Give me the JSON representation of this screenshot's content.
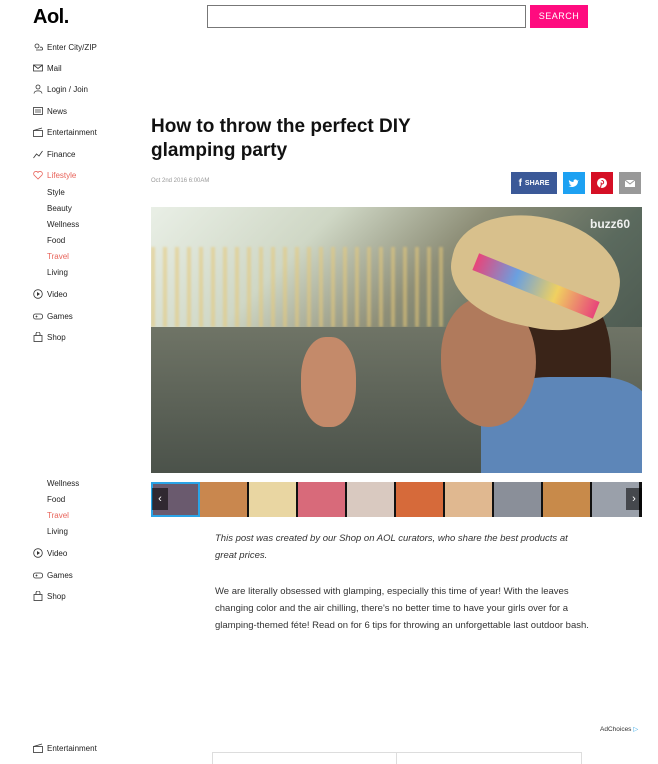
{
  "header": {
    "logo": "Aol.",
    "search_placeholder": "",
    "search_button": "SEARCH"
  },
  "sidebar": {
    "items": [
      {
        "label": "Enter City/ZIP",
        "icon": "weather-icon"
      },
      {
        "label": "Mail",
        "icon": "mail-icon"
      },
      {
        "label": "Login / Join",
        "icon": "user-icon"
      },
      {
        "label": "News",
        "icon": "news-icon"
      },
      {
        "label": "Entertainment",
        "icon": "clapper-icon"
      },
      {
        "label": "Finance",
        "icon": "chart-icon"
      },
      {
        "label": "Lifestyle",
        "icon": "heart-icon",
        "active": true
      }
    ],
    "lifestyle_sub": [
      "Style",
      "Beauty",
      "Wellness",
      "Food",
      "Travel",
      "Living"
    ],
    "more_items": [
      {
        "label": "Video",
        "icon": "play-icon"
      },
      {
        "label": "Games",
        "icon": "gamepad-icon"
      },
      {
        "label": "Shop",
        "icon": "bag-icon"
      }
    ],
    "repeat_sub": [
      "Wellness",
      "Food",
      "Travel",
      "Living"
    ],
    "repeat_items": [
      {
        "label": "Video",
        "icon": "play-icon"
      },
      {
        "label": "Games",
        "icon": "gamepad-icon"
      },
      {
        "label": "Shop",
        "icon": "bag-icon"
      }
    ],
    "bottom_item": {
      "label": "Entertainment",
      "icon": "clapper-icon"
    },
    "active_color": "#e8635a"
  },
  "article": {
    "title": "How to throw the perfect DIY glamping party",
    "date": "Oct 2nd 2016 6:00AM",
    "share_label": "SHARE",
    "video_watermark": "buzz60",
    "intro": "This post was created by our Shop on AOL curators, who share the best products at great prices.",
    "body": "We are literally obsessed with glamping, especially this time of year! With the leaves changing color and the air chilling, there's no better time to have your girls over for a glamping-themed féte! Read on for 6 tips for throwing an unforgettable last outdoor bash."
  },
  "thumbnails": [
    "#6a5a6e",
    "#c9874e",
    "#e9d6a2",
    "#d86a7a",
    "#d9c9c0",
    "#d66a3a",
    "#e0b890",
    "#8a8f99",
    "#c88a4a",
    "#9aa0aa"
  ],
  "ad": {
    "adchoices": "AdChoices"
  },
  "colors": {
    "search_button": "#ff0b7f",
    "facebook": "#3b5998",
    "twitter": "#1da1f2",
    "pinterest": "#d50f25",
    "mail": "#999999"
  }
}
